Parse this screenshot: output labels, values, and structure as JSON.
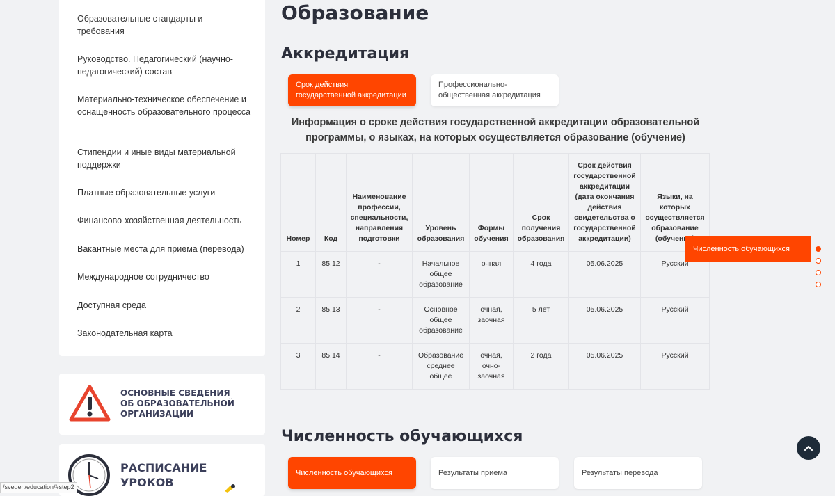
{
  "sidebar": {
    "items": [
      {
        "label": "Образовательные стандарты и требования"
      },
      {
        "label": "Руководство. Педагогический (научно-педагогический) состав"
      },
      {
        "label": "Материально-техническое обеспечение и оснащенность образовательного процесса"
      },
      {
        "label": "Стипендии и иные виды материальной поддержки"
      },
      {
        "label": "Платные образовательные услуги"
      },
      {
        "label": "Финансово-хозяйственная деятельность"
      },
      {
        "label": "Вакантные места для приема (перевода)"
      },
      {
        "label": "Международное сотрудничество"
      },
      {
        "label": "Доступная среда"
      },
      {
        "label": "Законодательная карта"
      }
    ],
    "banners": [
      {
        "text": "Основные сведения об образовательной организации",
        "lines": [
          "Основные сведения",
          "об образовательной",
          "организации"
        ],
        "icon": "warning-icon"
      },
      {
        "text": "Расписание уроков",
        "lines": [
          "Расписание",
          "уроков"
        ],
        "icon": "clock-icon"
      }
    ]
  },
  "page": {
    "title": "Образование"
  },
  "accreditation": {
    "title": "Аккредитация",
    "tabs": [
      {
        "label": "Срок действия государственной аккредитации",
        "active": true
      },
      {
        "label": "Профессионально-общественная аккредитация",
        "active": false
      }
    ],
    "heading": "Информация о сроке действия государственной аккредитации образовательной программы, о языках, на которых осуществляется образование (обучение)",
    "table": {
      "headers": [
        "Номер",
        "Код",
        "Наименование профессии, специальности, направления подготовки",
        "Уровень образования",
        "Формы обучения",
        "Срок получения образования",
        "Срок действия государственной аккредитации (дата окончания действия свидетельства о государственной аккредитации)",
        "Языки, на которых осуществляется образование (обучение)"
      ],
      "rows": [
        [
          "1",
          "85.12",
          "-",
          "Начальное общее образование",
          "очная",
          "4 года",
          "05.06.2025",
          "Русский"
        ],
        [
          "2",
          "85.13",
          "-",
          "Основное общее образование",
          "очная, заочная",
          "5 лет",
          "05.06.2025",
          "Русский"
        ],
        [
          "3",
          "85.14",
          "-",
          "Образование среднее общее",
          "очная, очно-заочная",
          "2 года",
          "05.06.2025",
          "Русский"
        ]
      ]
    }
  },
  "students": {
    "title": "Численность обучающихся",
    "tabs": [
      {
        "label": "Численность обучающихся",
        "active": true
      },
      {
        "label": "Результаты приема",
        "active": false
      },
      {
        "label": "Результаты перевода",
        "active": false
      }
    ]
  },
  "float_nav": {
    "label": "Численность обучающихся",
    "dots": 4,
    "active_dot": 0
  },
  "status_bar": {
    "url": "/sveden/education/#step2"
  },
  "colors": {
    "accent": "#ff4500",
    "background": "#f1f2f4",
    "dark": "#1e2b38"
  }
}
